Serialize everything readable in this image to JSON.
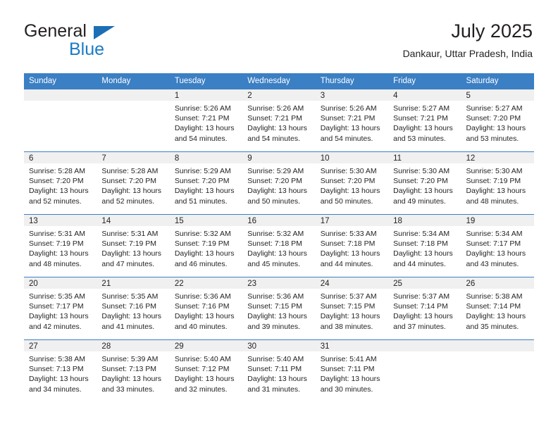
{
  "brand": {
    "name_part1": "General",
    "name_part2": "Blue",
    "triangle_color": "#1c6fb5",
    "blue_color": "#1c7bc4"
  },
  "header": {
    "title": "July 2025",
    "subtitle": "Dankaur, Uttar Pradesh, India"
  },
  "theme": {
    "header_blue": "#3b7fc4",
    "daynum_bg": "#f0f0f0",
    "text": "#231f20"
  },
  "weekdays": [
    "Sunday",
    "Monday",
    "Tuesday",
    "Wednesday",
    "Thursday",
    "Friday",
    "Saturday"
  ],
  "labels": {
    "sunrise": "Sunrise:",
    "sunset": "Sunset:",
    "daylight": "Daylight:"
  },
  "weeks": [
    [
      {
        "day": "",
        "blank": true,
        "sunrise": "",
        "sunset": "",
        "daylight_line1": "",
        "daylight_line2": ""
      },
      {
        "day": "",
        "blank": true,
        "sunrise": "",
        "sunset": "",
        "daylight_line1": "",
        "daylight_line2": ""
      },
      {
        "day": "1",
        "blank": false,
        "sunrise": "Sunrise: 5:26 AM",
        "sunset": "Sunset: 7:21 PM",
        "daylight_line1": "Daylight: 13 hours",
        "daylight_line2": "and 54 minutes."
      },
      {
        "day": "2",
        "blank": false,
        "sunrise": "Sunrise: 5:26 AM",
        "sunset": "Sunset: 7:21 PM",
        "daylight_line1": "Daylight: 13 hours",
        "daylight_line2": "and 54 minutes."
      },
      {
        "day": "3",
        "blank": false,
        "sunrise": "Sunrise: 5:26 AM",
        "sunset": "Sunset: 7:21 PM",
        "daylight_line1": "Daylight: 13 hours",
        "daylight_line2": "and 54 minutes."
      },
      {
        "day": "4",
        "blank": false,
        "sunrise": "Sunrise: 5:27 AM",
        "sunset": "Sunset: 7:21 PM",
        "daylight_line1": "Daylight: 13 hours",
        "daylight_line2": "and 53 minutes."
      },
      {
        "day": "5",
        "blank": false,
        "sunrise": "Sunrise: 5:27 AM",
        "sunset": "Sunset: 7:20 PM",
        "daylight_line1": "Daylight: 13 hours",
        "daylight_line2": "and 53 minutes."
      }
    ],
    [
      {
        "day": "6",
        "blank": false,
        "sunrise": "Sunrise: 5:28 AM",
        "sunset": "Sunset: 7:20 PM",
        "daylight_line1": "Daylight: 13 hours",
        "daylight_line2": "and 52 minutes."
      },
      {
        "day": "7",
        "blank": false,
        "sunrise": "Sunrise: 5:28 AM",
        "sunset": "Sunset: 7:20 PM",
        "daylight_line1": "Daylight: 13 hours",
        "daylight_line2": "and 52 minutes."
      },
      {
        "day": "8",
        "blank": false,
        "sunrise": "Sunrise: 5:29 AM",
        "sunset": "Sunset: 7:20 PM",
        "daylight_line1": "Daylight: 13 hours",
        "daylight_line2": "and 51 minutes."
      },
      {
        "day": "9",
        "blank": false,
        "sunrise": "Sunrise: 5:29 AM",
        "sunset": "Sunset: 7:20 PM",
        "daylight_line1": "Daylight: 13 hours",
        "daylight_line2": "and 50 minutes."
      },
      {
        "day": "10",
        "blank": false,
        "sunrise": "Sunrise: 5:30 AM",
        "sunset": "Sunset: 7:20 PM",
        "daylight_line1": "Daylight: 13 hours",
        "daylight_line2": "and 50 minutes."
      },
      {
        "day": "11",
        "blank": false,
        "sunrise": "Sunrise: 5:30 AM",
        "sunset": "Sunset: 7:20 PM",
        "daylight_line1": "Daylight: 13 hours",
        "daylight_line2": "and 49 minutes."
      },
      {
        "day": "12",
        "blank": false,
        "sunrise": "Sunrise: 5:30 AM",
        "sunset": "Sunset: 7:19 PM",
        "daylight_line1": "Daylight: 13 hours",
        "daylight_line2": "and 48 minutes."
      }
    ],
    [
      {
        "day": "13",
        "blank": false,
        "sunrise": "Sunrise: 5:31 AM",
        "sunset": "Sunset: 7:19 PM",
        "daylight_line1": "Daylight: 13 hours",
        "daylight_line2": "and 48 minutes."
      },
      {
        "day": "14",
        "blank": false,
        "sunrise": "Sunrise: 5:31 AM",
        "sunset": "Sunset: 7:19 PM",
        "daylight_line1": "Daylight: 13 hours",
        "daylight_line2": "and 47 minutes."
      },
      {
        "day": "15",
        "blank": false,
        "sunrise": "Sunrise: 5:32 AM",
        "sunset": "Sunset: 7:19 PM",
        "daylight_line1": "Daylight: 13 hours",
        "daylight_line2": "and 46 minutes."
      },
      {
        "day": "16",
        "blank": false,
        "sunrise": "Sunrise: 5:32 AM",
        "sunset": "Sunset: 7:18 PM",
        "daylight_line1": "Daylight: 13 hours",
        "daylight_line2": "and 45 minutes."
      },
      {
        "day": "17",
        "blank": false,
        "sunrise": "Sunrise: 5:33 AM",
        "sunset": "Sunset: 7:18 PM",
        "daylight_line1": "Daylight: 13 hours",
        "daylight_line2": "and 44 minutes."
      },
      {
        "day": "18",
        "blank": false,
        "sunrise": "Sunrise: 5:34 AM",
        "sunset": "Sunset: 7:18 PM",
        "daylight_line1": "Daylight: 13 hours",
        "daylight_line2": "and 44 minutes."
      },
      {
        "day": "19",
        "blank": false,
        "sunrise": "Sunrise: 5:34 AM",
        "sunset": "Sunset: 7:17 PM",
        "daylight_line1": "Daylight: 13 hours",
        "daylight_line2": "and 43 minutes."
      }
    ],
    [
      {
        "day": "20",
        "blank": false,
        "sunrise": "Sunrise: 5:35 AM",
        "sunset": "Sunset: 7:17 PM",
        "daylight_line1": "Daylight: 13 hours",
        "daylight_line2": "and 42 minutes."
      },
      {
        "day": "21",
        "blank": false,
        "sunrise": "Sunrise: 5:35 AM",
        "sunset": "Sunset: 7:16 PM",
        "daylight_line1": "Daylight: 13 hours",
        "daylight_line2": "and 41 minutes."
      },
      {
        "day": "22",
        "blank": false,
        "sunrise": "Sunrise: 5:36 AM",
        "sunset": "Sunset: 7:16 PM",
        "daylight_line1": "Daylight: 13 hours",
        "daylight_line2": "and 40 minutes."
      },
      {
        "day": "23",
        "blank": false,
        "sunrise": "Sunrise: 5:36 AM",
        "sunset": "Sunset: 7:15 PM",
        "daylight_line1": "Daylight: 13 hours",
        "daylight_line2": "and 39 minutes."
      },
      {
        "day": "24",
        "blank": false,
        "sunrise": "Sunrise: 5:37 AM",
        "sunset": "Sunset: 7:15 PM",
        "daylight_line1": "Daylight: 13 hours",
        "daylight_line2": "and 38 minutes."
      },
      {
        "day": "25",
        "blank": false,
        "sunrise": "Sunrise: 5:37 AM",
        "sunset": "Sunset: 7:14 PM",
        "daylight_line1": "Daylight: 13 hours",
        "daylight_line2": "and 37 minutes."
      },
      {
        "day": "26",
        "blank": false,
        "sunrise": "Sunrise: 5:38 AM",
        "sunset": "Sunset: 7:14 PM",
        "daylight_line1": "Daylight: 13 hours",
        "daylight_line2": "and 35 minutes."
      }
    ],
    [
      {
        "day": "27",
        "blank": false,
        "sunrise": "Sunrise: 5:38 AM",
        "sunset": "Sunset: 7:13 PM",
        "daylight_line1": "Daylight: 13 hours",
        "daylight_line2": "and 34 minutes."
      },
      {
        "day": "28",
        "blank": false,
        "sunrise": "Sunrise: 5:39 AM",
        "sunset": "Sunset: 7:13 PM",
        "daylight_line1": "Daylight: 13 hours",
        "daylight_line2": "and 33 minutes."
      },
      {
        "day": "29",
        "blank": false,
        "sunrise": "Sunrise: 5:40 AM",
        "sunset": "Sunset: 7:12 PM",
        "daylight_line1": "Daylight: 13 hours",
        "daylight_line2": "and 32 minutes."
      },
      {
        "day": "30",
        "blank": false,
        "sunrise": "Sunrise: 5:40 AM",
        "sunset": "Sunset: 7:11 PM",
        "daylight_line1": "Daylight: 13 hours",
        "daylight_line2": "and 31 minutes."
      },
      {
        "day": "31",
        "blank": false,
        "sunrise": "Sunrise: 5:41 AM",
        "sunset": "Sunset: 7:11 PM",
        "daylight_line1": "Daylight: 13 hours",
        "daylight_line2": "and 30 minutes."
      },
      {
        "day": "",
        "blank": true,
        "sunrise": "",
        "sunset": "",
        "daylight_line1": "",
        "daylight_line2": ""
      },
      {
        "day": "",
        "blank": true,
        "sunrise": "",
        "sunset": "",
        "daylight_line1": "",
        "daylight_line2": ""
      }
    ]
  ]
}
